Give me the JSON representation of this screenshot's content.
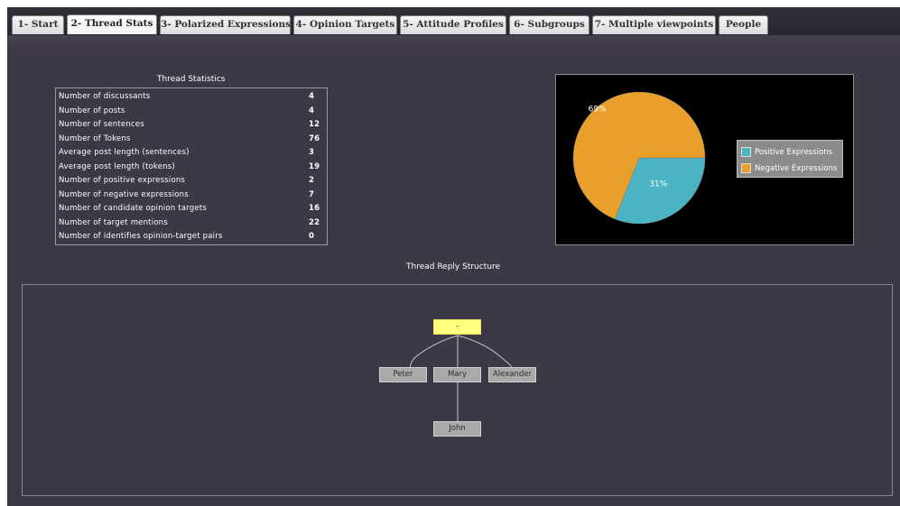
{
  "tabs": [
    {
      "label": "1- Start",
      "active": false
    },
    {
      "label": "2- Thread Stats",
      "active": true
    },
    {
      "label": "3- Polarized Expressions",
      "active": false
    },
    {
      "label": "4- Opinion Targets",
      "active": false
    },
    {
      "label": "5- Attitude Profiles",
      "active": false
    },
    {
      "label": "6- Subgroups",
      "active": false
    },
    {
      "label": "7- Multiple viewpoints",
      "active": false
    },
    {
      "label": "People",
      "active": false
    }
  ],
  "stats": {
    "title": "Thread Statistics",
    "rows": [
      {
        "label": "Number of discussants",
        "value": "4"
      },
      {
        "label": "Number of posts",
        "value": "4"
      },
      {
        "label": "Number of sentences",
        "value": "12"
      },
      {
        "label": "Number of Tokens",
        "value": "76"
      },
      {
        "label": "Average post length (sentences)",
        "value": "3"
      },
      {
        "label": "Average post length (tokens)",
        "value": "19"
      },
      {
        "label": "Number of positive expressions",
        "value": "2"
      },
      {
        "label": "Number of negative expressions",
        "value": "7"
      },
      {
        "label": "Number of candidate opinion targets",
        "value": "16"
      },
      {
        "label": "Number of target mentions",
        "value": "22"
      },
      {
        "label": "Number of identifies opinion-target pairs",
        "value": "0"
      }
    ]
  },
  "chart_data": {
    "type": "pie",
    "slices": [
      {
        "label": "Positive Expressions",
        "value": 31,
        "display": "31%",
        "color": "#4ab3c4"
      },
      {
        "label": "Negative Expressions",
        "value": 69,
        "display": "69%",
        "color": "#e8a02a"
      }
    ],
    "legend_position": "right"
  },
  "tree": {
    "title": "Thread Reply Structure",
    "root": "-",
    "children": [
      "Peter",
      "Mary",
      "Alexander"
    ],
    "grandchild": "John"
  },
  "colors": {
    "background": "#3d3845",
    "root_node": "#ffff80",
    "node": "#a9a9a9",
    "positive": "#4ab3c4",
    "negative": "#e8a02a"
  }
}
